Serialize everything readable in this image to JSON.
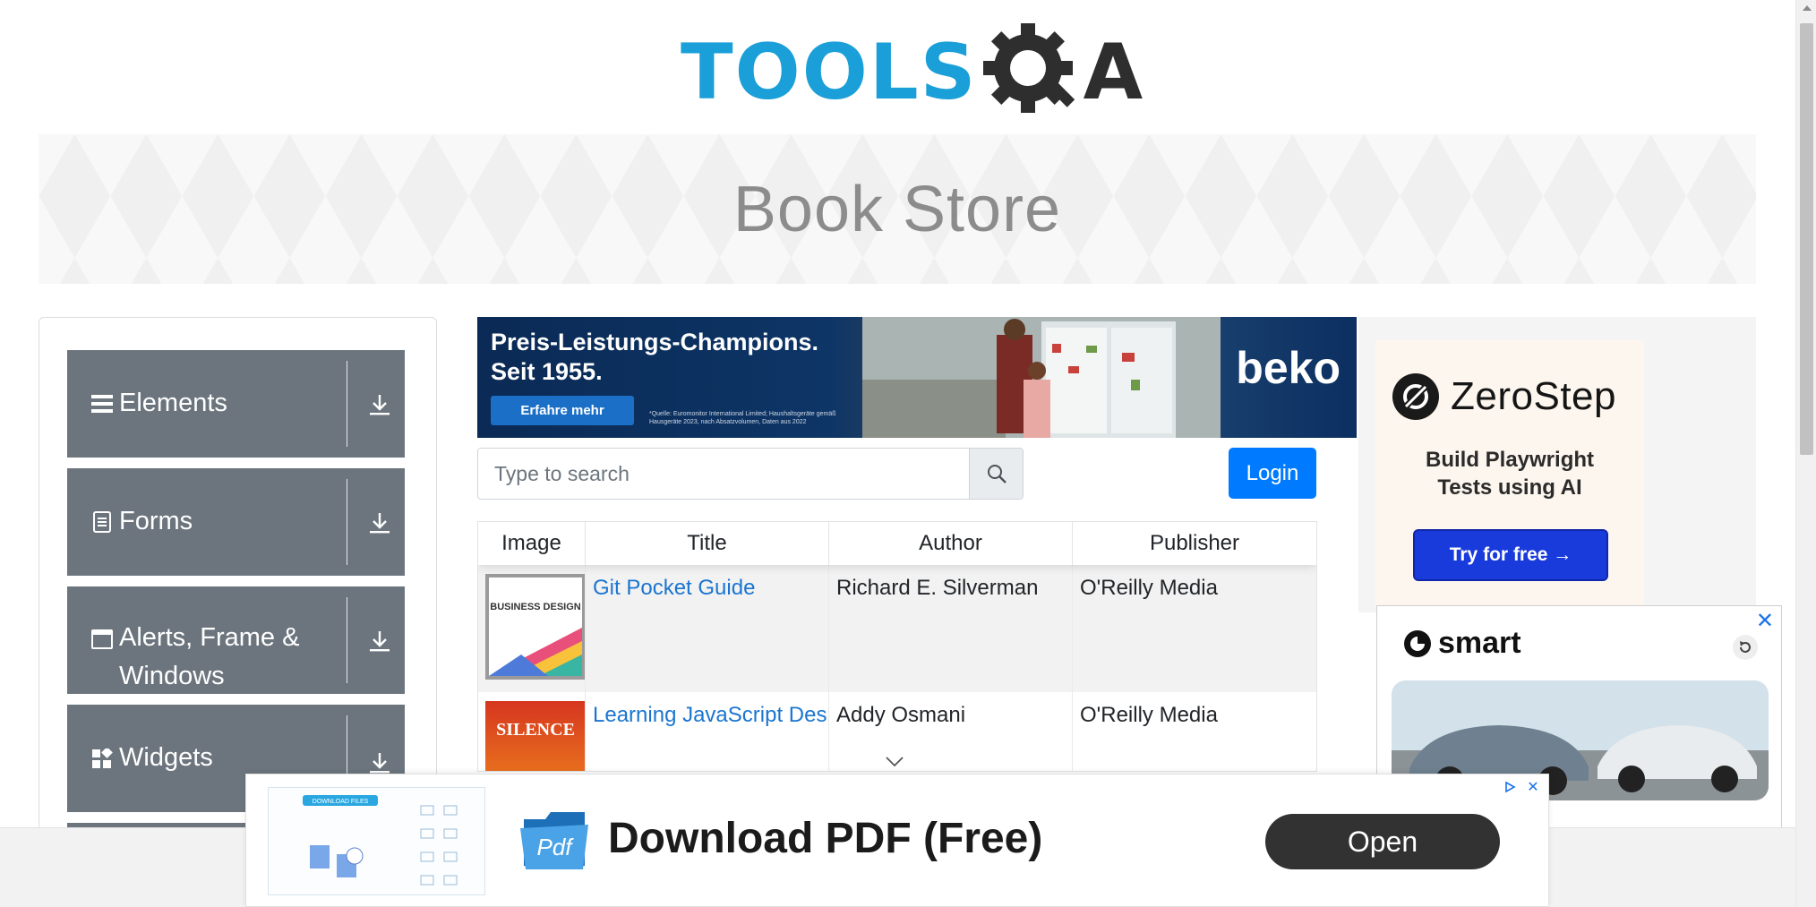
{
  "header": {
    "logo_part1": "TOOLS",
    "logo_part2": "A"
  },
  "banner": {
    "title": "Book Store"
  },
  "sidebar": {
    "groups": [
      {
        "label": "Elements",
        "icon": "hamburger-icon"
      },
      {
        "label": "Forms",
        "icon": "document-icon"
      },
      {
        "label": "Alerts, Frame & Windows",
        "icon": "window-icon"
      },
      {
        "label": "Widgets",
        "icon": "widgets-icon"
      }
    ]
  },
  "top_ad": {
    "headline_line1": "Preis-Leistungs-Champions.",
    "headline_line2": "Seit 1955.",
    "cta": "Erfahre mehr",
    "fine_print": "*Quelle: Euromonitor International Limited; Haushaltsgeräte gemäß Hausgeräte 2023, nach Absatzvolumen, Daten aus 2022",
    "brand": "beko"
  },
  "search": {
    "placeholder": "Type to search"
  },
  "login": {
    "label": "Login"
  },
  "table": {
    "headers": [
      "Image",
      "Title",
      "Author",
      "Publisher"
    ],
    "rows": [
      {
        "title": "Git Pocket Guide",
        "author": "Richard E. Silverman",
        "publisher": "O'Reilly Media",
        "cover_text": "BUSINESS DESIGN"
      },
      {
        "title": "Learning JavaScript Design Patterns",
        "author": "Addy Osmani",
        "publisher": "O'Reilly Media",
        "cover_text": "SILENCE"
      }
    ]
  },
  "zerostep_ad": {
    "name": "ZeroStep",
    "subtitle_line1": "Build Playwright",
    "subtitle_line2": "Tests using AI",
    "cta": "Try for free →"
  },
  "smart_ad": {
    "brand": "smart"
  },
  "bottom_ad": {
    "thumb_header": "DOWNLOAD FILES",
    "icon_text": "Pdf",
    "title": "Download PDF (Free)",
    "cta": "Open"
  },
  "colors": {
    "tools_blue": "#1a9fd8",
    "sidebar_grey": "#6c757d",
    "login_blue": "#007bff",
    "link_blue": "#1b75d0"
  }
}
